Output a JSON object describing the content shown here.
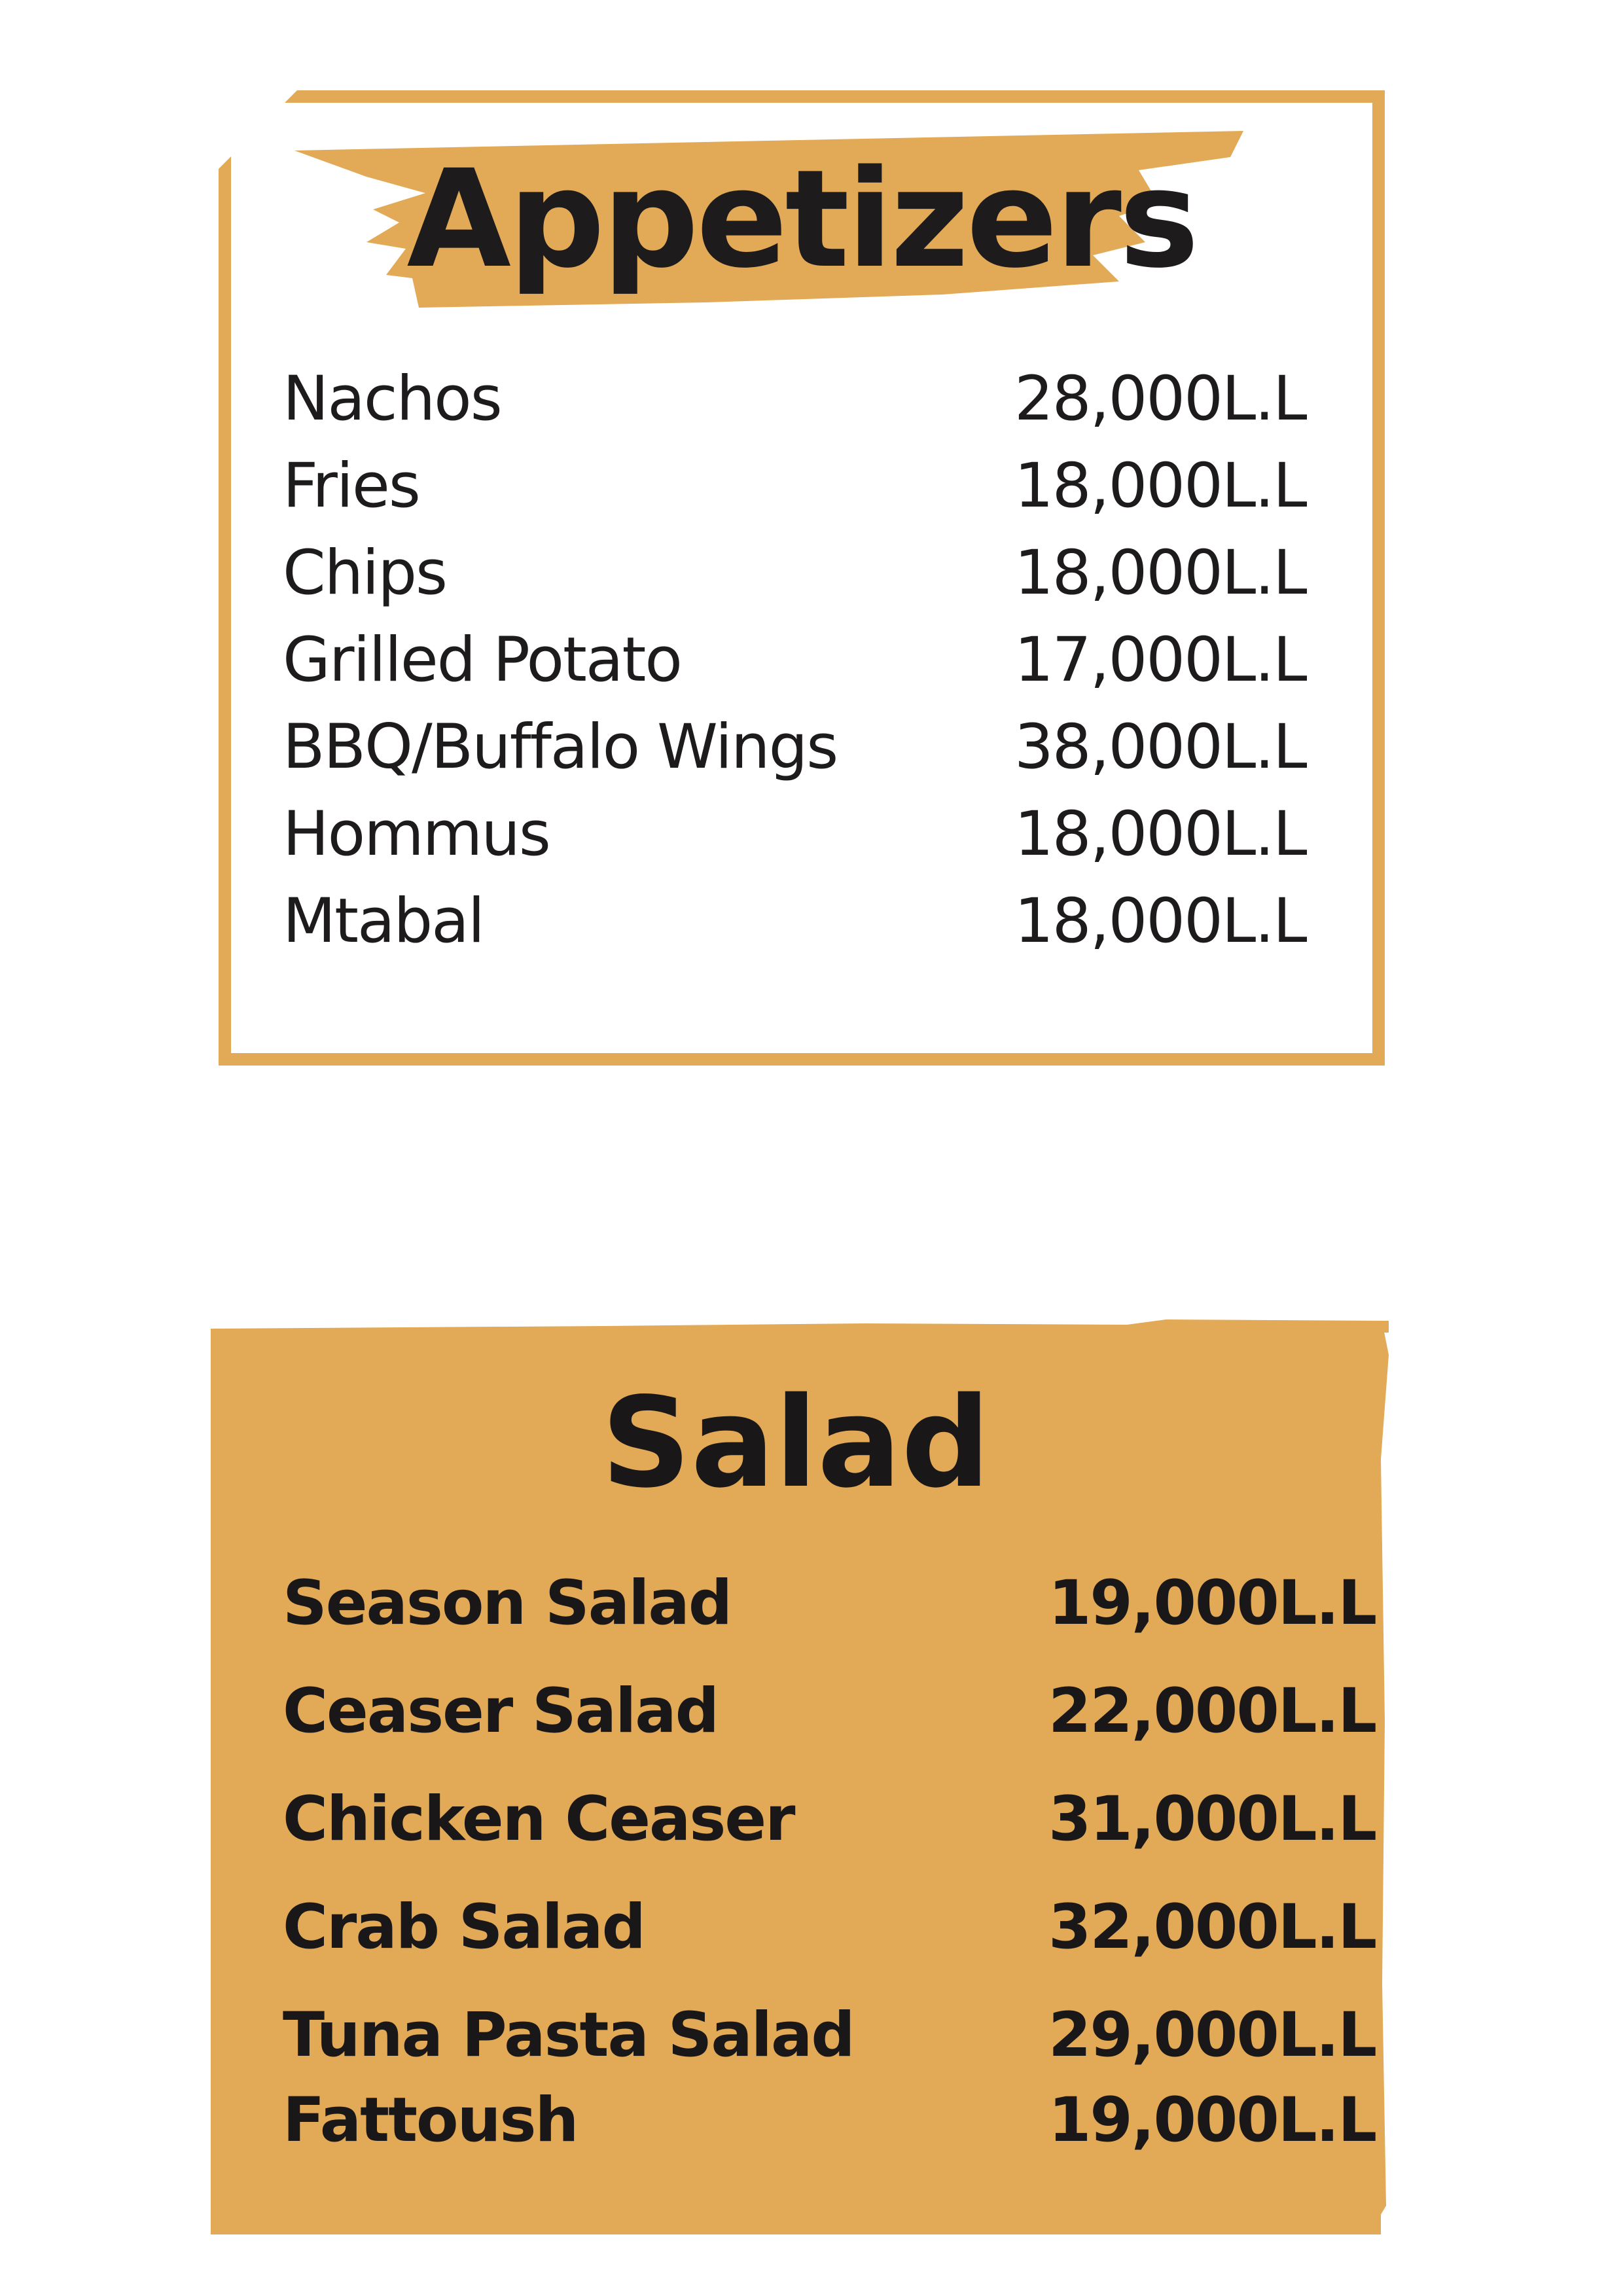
{
  "appetizers": {
    "title": "Appetizers",
    "items": [
      {
        "name": "Nachos",
        "price": "28,000L.L"
      },
      {
        "name": "Fries",
        "price": "18,000L.L"
      },
      {
        "name": "Chips",
        "price": "18,000L.L"
      },
      {
        "name": "Grilled Potato",
        "price": "17,000L.L"
      },
      {
        "name": "BBQ/Buffalo Wings",
        "price": "38,000L.L"
      },
      {
        "name": "Hommus",
        "price": "18,000L.L"
      },
      {
        "name": "Mtabal",
        "price": "18,000L.L"
      }
    ]
  },
  "salad": {
    "title": "Salad",
    "items": [
      {
        "name": "Season Salad",
        "price": "19,000L.L"
      },
      {
        "name": "Ceaser Salad",
        "price": "22,000L.L"
      },
      {
        "name": "Chicken Ceaser",
        "price": "31,000L.L"
      },
      {
        "name": "Crab Salad",
        "price": "32,000L.L"
      },
      {
        "name": "Tuna Pasta Salad",
        "price": "29,000L.L"
      },
      {
        "name": "Fattoush",
        "price": "19,000L.L"
      }
    ]
  },
  "colors": {
    "accent": "#e2a956",
    "text": "#1e1b1c",
    "background": "#ffffff"
  }
}
